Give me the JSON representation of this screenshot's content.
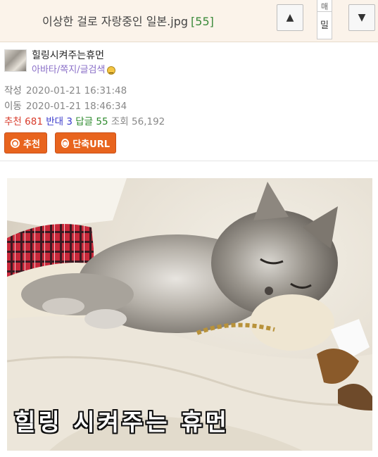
{
  "post": {
    "title": "이상한 걸로 자랑중인 일본.jpg",
    "comment_count": "[55]"
  },
  "nav": {
    "up_icon": "triangle-up-icon",
    "down_icon": "triangle-down-icon",
    "tab_top": "매",
    "tab_bottom": "밀"
  },
  "author": {
    "nickname": "힐링시켜주는휴먼",
    "link_avatar": "아바타",
    "sep": "/",
    "link_message": "쪽지",
    "link_search": "글검색"
  },
  "meta": {
    "written_label": "작성",
    "written": "2020-01-21 16:31:48",
    "moved_label": "이동",
    "moved": "2020-01-21 18:46:34",
    "recommend_label": "추천",
    "recommend": "681",
    "oppose_label": "반대",
    "oppose": "3",
    "reply_label": "답글",
    "reply": "55",
    "views_label": "조회",
    "views": "56,192"
  },
  "buttons": {
    "recommend": "추천",
    "short_url": "단축URL"
  },
  "image": {
    "caption": "힐링 시켜주는 휴먼"
  },
  "colors": {
    "accent": "#e8641e",
    "recommend": "#d83a2a",
    "oppose": "#3a3acb",
    "reply": "#2c8a2c",
    "link": "#8a6fc8"
  }
}
